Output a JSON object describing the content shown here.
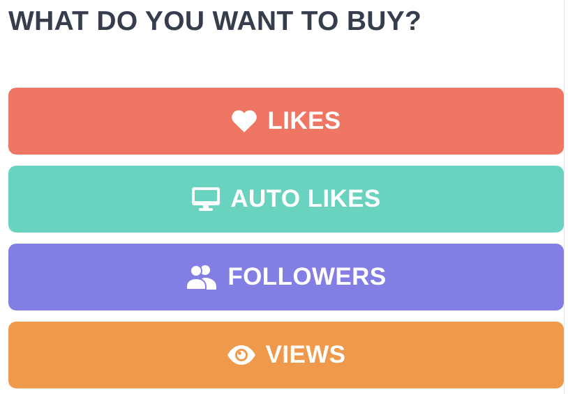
{
  "page": {
    "title": "WHAT DO YOU WANT TO BUY?"
  },
  "options": [
    {
      "label": "LIKES",
      "icon": "heart-icon",
      "color": "#ef7663"
    },
    {
      "label": "AUTO LIKES",
      "icon": "monitor-icon",
      "color": "#69d3c0"
    },
    {
      "label": "FOLLOWERS",
      "icon": "users-icon",
      "color": "#837ee4"
    },
    {
      "label": "VIEWS",
      "icon": "eye-icon",
      "color": "#ef994c"
    }
  ]
}
